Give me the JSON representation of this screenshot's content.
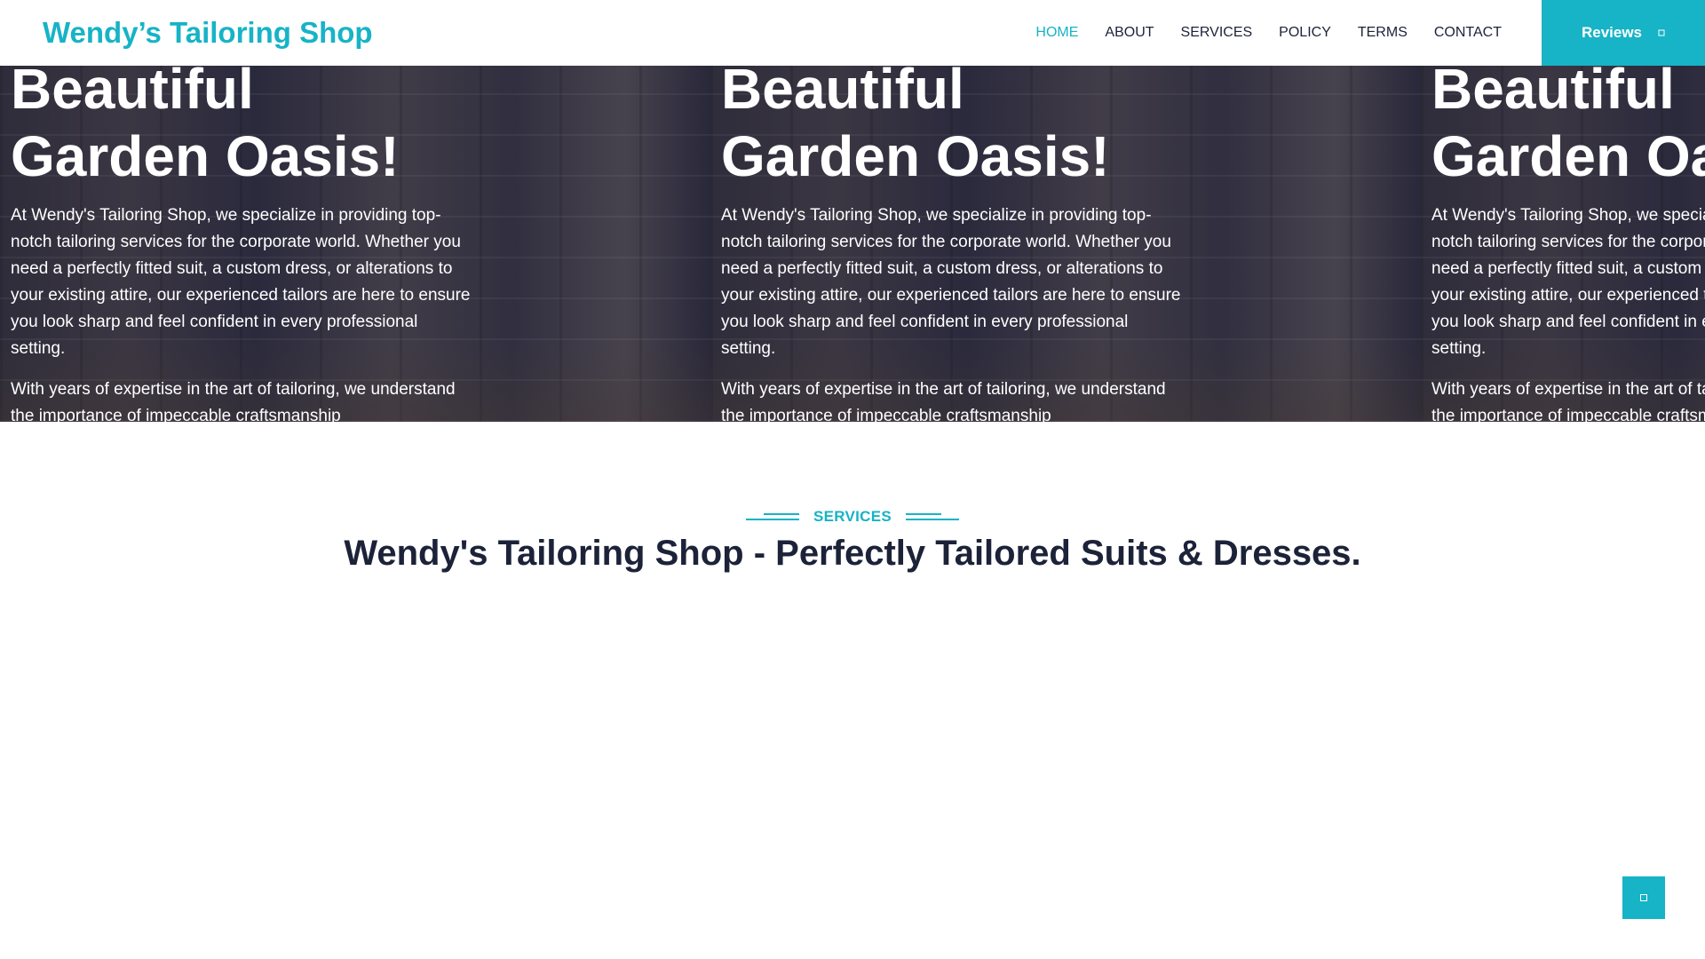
{
  "header": {
    "brand": "Wendy’s Tailoring Shop",
    "nav": [
      {
        "label": "HOME",
        "active": true
      },
      {
        "label": "ABOUT",
        "active": false
      },
      {
        "label": "SERVICES",
        "active": false
      },
      {
        "label": "POLICY",
        "active": false
      },
      {
        "label": "TERMS",
        "active": false
      },
      {
        "label": "CONTACT",
        "active": false
      }
    ],
    "reviews_label": "Reviews",
    "reviews_icon": "chevron-down-icon"
  },
  "hero": {
    "slides": [
      {
        "title": "Beautiful\nGarden Oasis!",
        "paragraph1": "At Wendy's Tailoring Shop, we specialize in providing top-notch tailoring services for the corporate world. Whether you need a perfectly fitted suit, a custom dress, or alterations to your existing attire, our experienced tailors are here to ensure you look sharp and feel confident in every professional setting.",
        "paragraph2": "With years of expertise in the art of tailoring, we understand the importance of impeccable craftsmanship"
      },
      {
        "title": "Beautiful\nGarden Oasis!",
        "paragraph1": "At Wendy's Tailoring Shop, we specialize in providing top-notch tailoring services for the corporate world. Whether you need a perfectly fitted suit, a custom dress, or alterations to your existing attire, our experienced tailors are here to ensure you look sharp and feel confident in every professional setting.",
        "paragraph2": "With years of expertise in the art of tailoring, we understand the importance of impeccable craftsmanship"
      },
      {
        "title": "Beautiful\nGarden Oasis!",
        "paragraph1": "At Wendy's Tailoring Shop, we specialize in providing top-notch tailoring services for the corporate world. Whether you need a perfectly fitted suit, a custom dress, or alterations to your existing attire, our experienced tailors are here to ensure you look sharp and feel confident in every professional setting.",
        "paragraph2": "With years of expertise in the art of tailoring, we understand the importance of impeccable craftsmanship"
      }
    ]
  },
  "services": {
    "eyebrow": "SERVICES",
    "title": "Wendy's Tailoring Shop - Perfectly Tailored Suits & Dresses."
  },
  "back_to_top_icon": "chevron-up-icon",
  "colors": {
    "accent": "#17b3c6",
    "heading": "#1c2238"
  }
}
